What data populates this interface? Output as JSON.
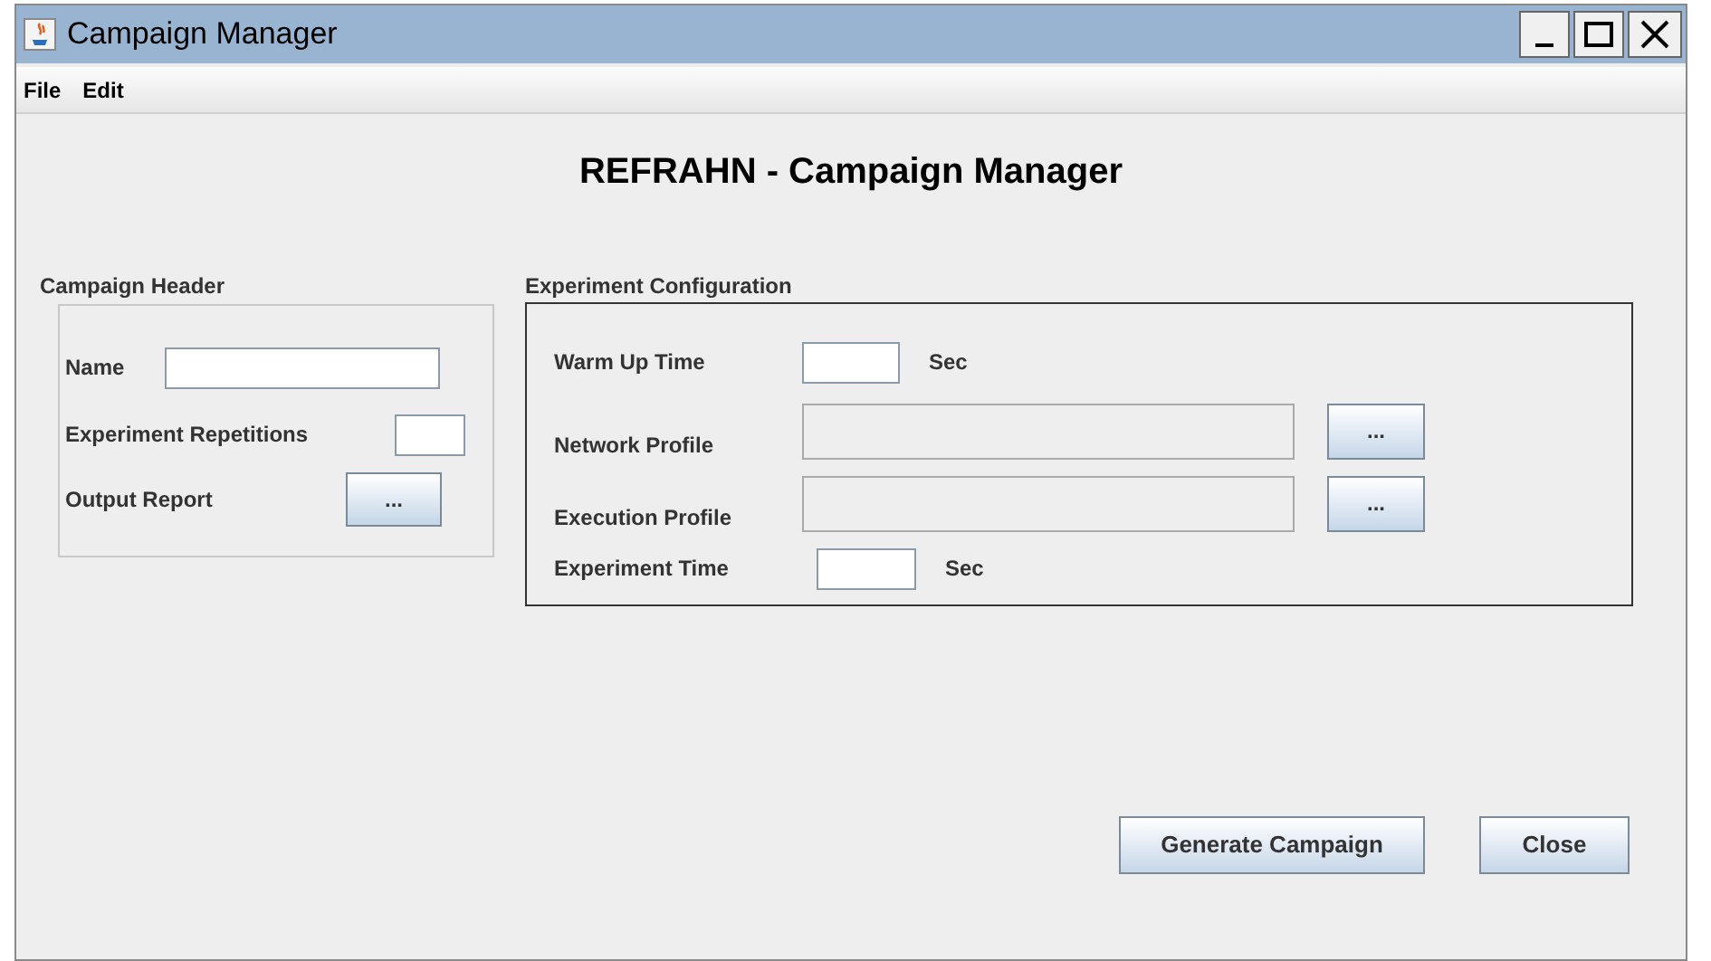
{
  "window": {
    "title": "Campaign Manager"
  },
  "menu": [
    "File",
    "Edit"
  ],
  "heading": "REFRAHN - Campaign Manager",
  "campaign_header": {
    "title": "Campaign Header",
    "rows": [
      {
        "kind": "text",
        "label": "Name"
      },
      {
        "kind": "text",
        "label": "Experiment Repetitions"
      },
      {
        "kind": "button",
        "label": "Output Report",
        "button": "..."
      }
    ]
  },
  "experiment_configuration": {
    "title": "Experiment Configuration",
    "rows": [
      {
        "kind": "text",
        "label": "Warm Up Time",
        "unit": "Sec"
      },
      {
        "kind": "path",
        "label": "Network Profile",
        "button": "..."
      },
      {
        "kind": "path",
        "label": "Execution Profile",
        "button": "..."
      },
      {
        "kind": "text",
        "label": "Experiment Time",
        "unit": "Sec"
      }
    ]
  },
  "buttons": [
    "Generate Campaign",
    "Close"
  ]
}
